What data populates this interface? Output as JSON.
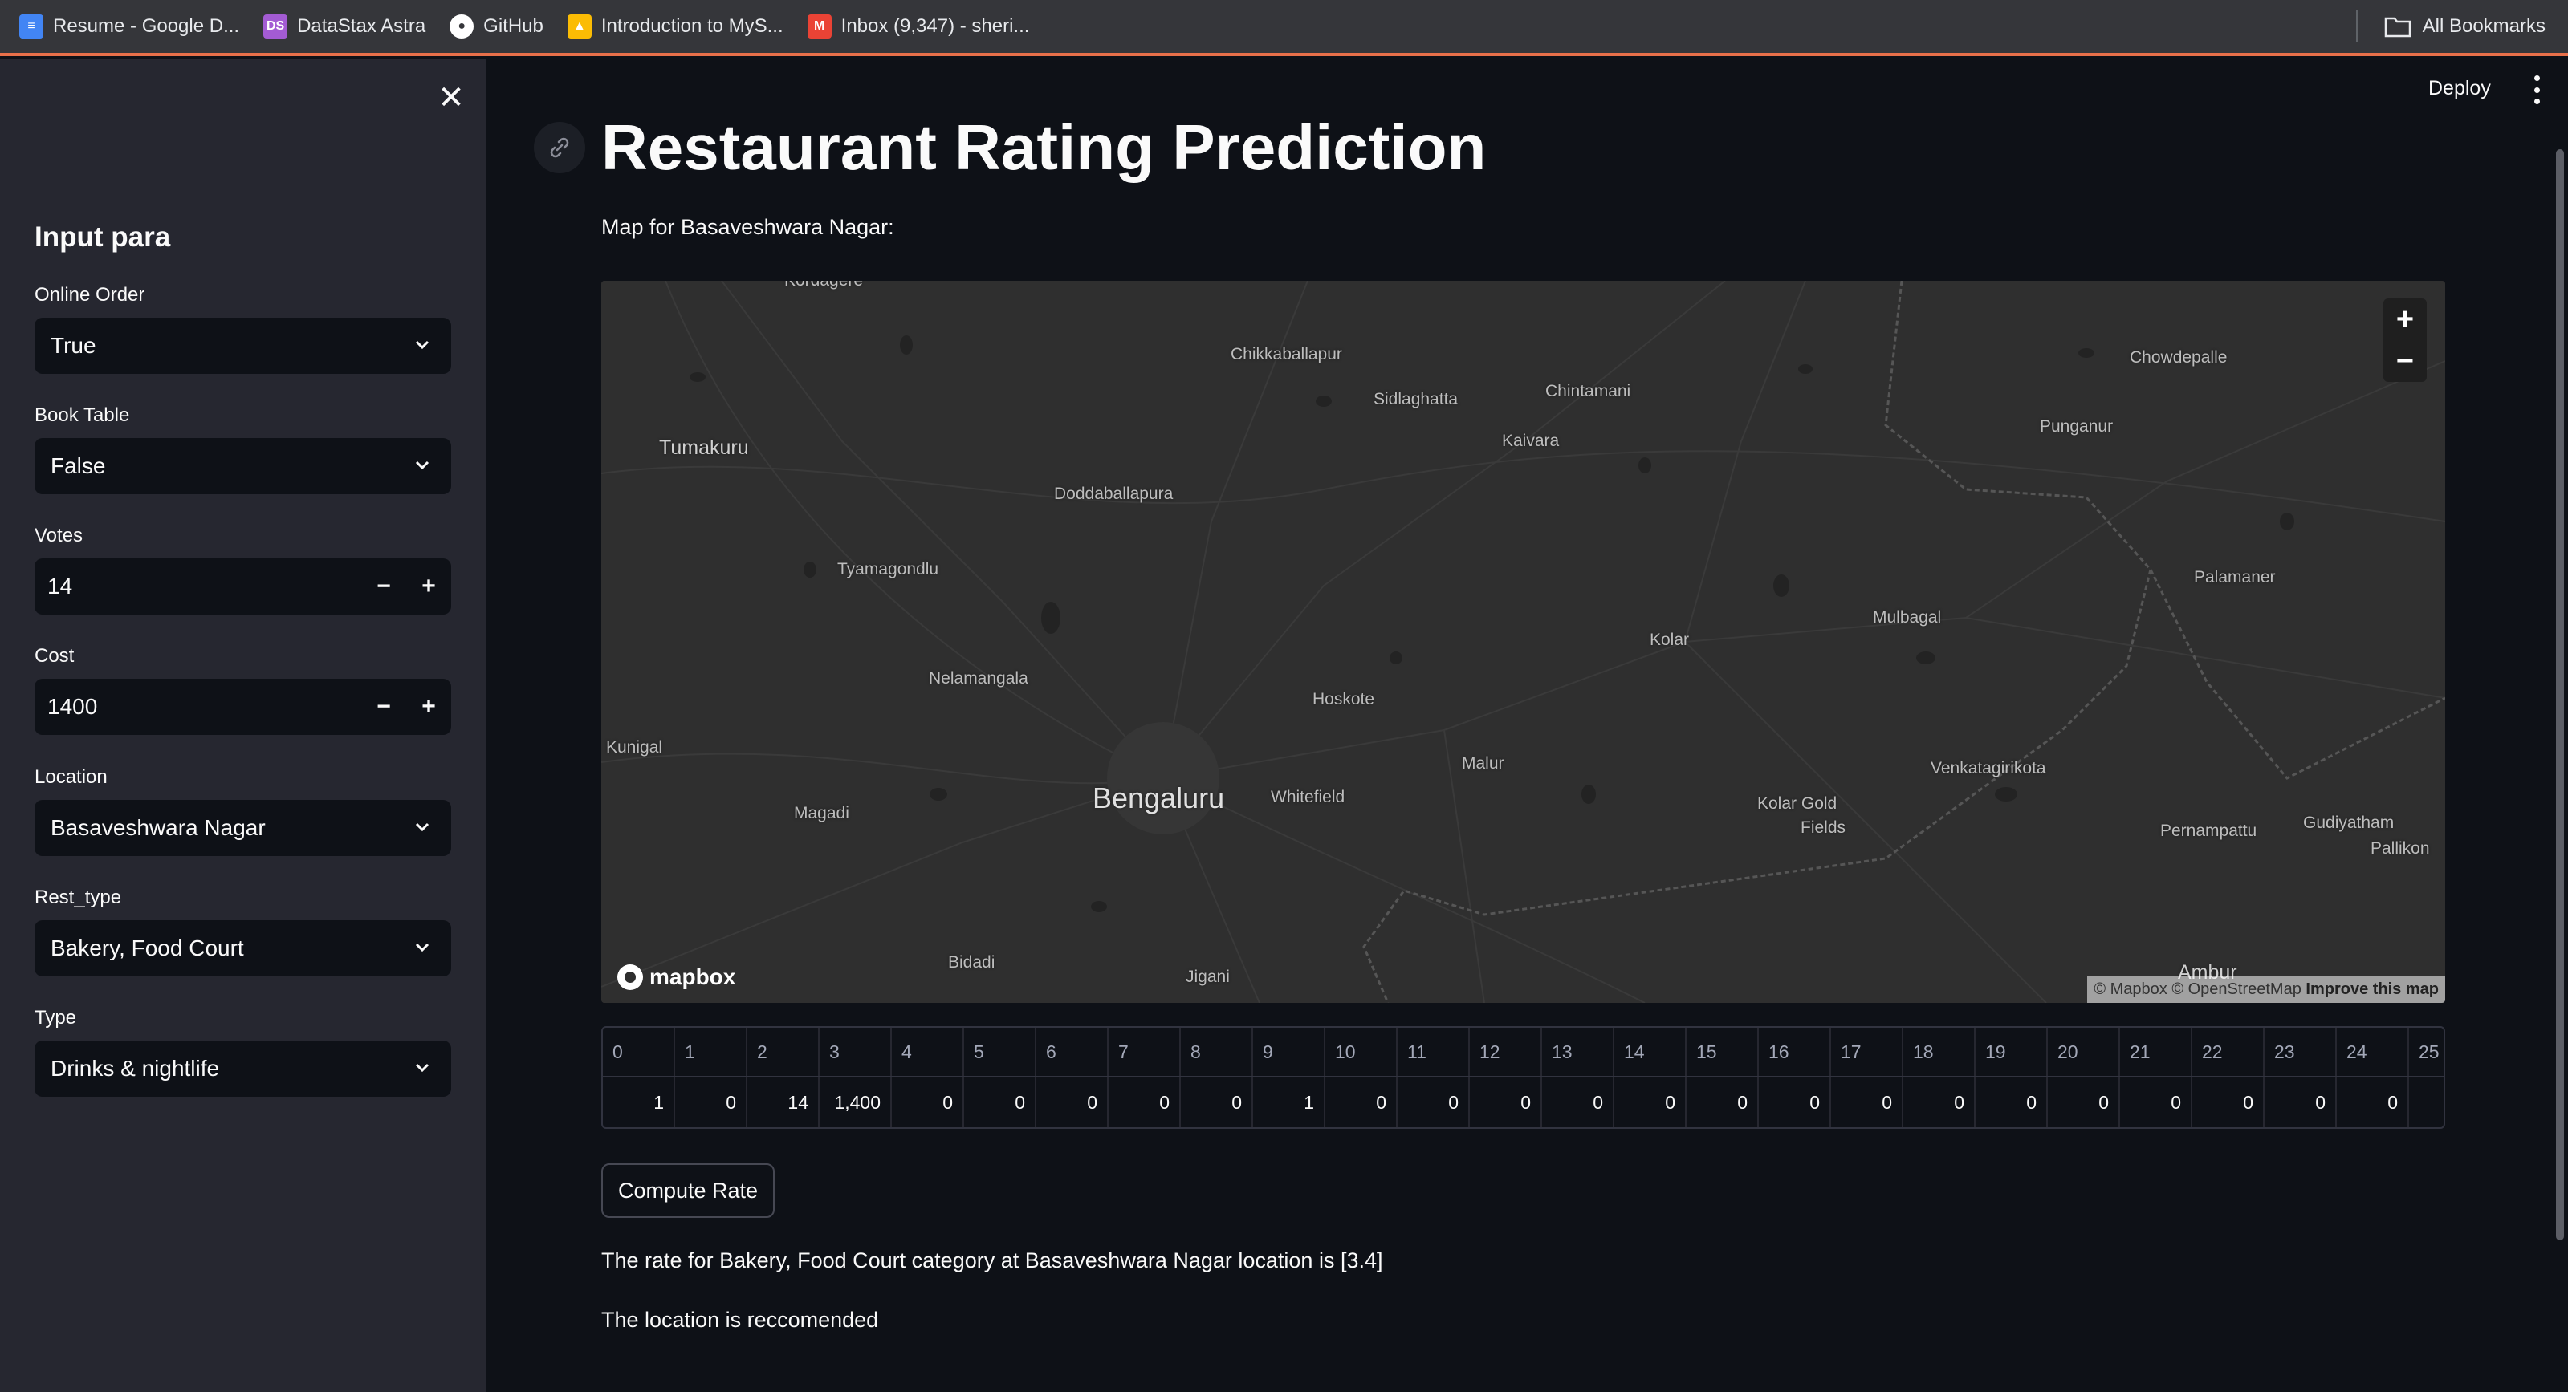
{
  "bookmarks": [
    {
      "label": "Resume - Google D...",
      "icon": "google-docs-icon",
      "color": "#4285f4"
    },
    {
      "label": "DataStax Astra",
      "icon": "datastax-icon",
      "color": "#a35bd3"
    },
    {
      "label": "GitHub",
      "icon": "github-icon",
      "color": "#ffffff"
    },
    {
      "label": "Introduction to MyS...",
      "icon": "google-drive-icon",
      "color": "#fbbc04"
    },
    {
      "label": "Inbox (9,347) - sheri...",
      "icon": "gmail-icon",
      "color": "#ea4335"
    }
  ],
  "all_bookmarks": "All Bookmarks",
  "sidebar": {
    "title": "Input para",
    "online_order": {
      "label": "Online Order",
      "value": "True"
    },
    "book_table": {
      "label": "Book Table",
      "value": "False"
    },
    "votes": {
      "label": "Votes",
      "value": "14",
      "minus": "−",
      "plus": "+"
    },
    "cost": {
      "label": "Cost",
      "value": "1400",
      "minus": "−",
      "plus": "+"
    },
    "location": {
      "label": "Location",
      "value": "Basaveshwara Nagar"
    },
    "rest_type": {
      "label": "Rest_type",
      "value": "Bakery, Food Court"
    },
    "type": {
      "label": "Type",
      "value": "Drinks & nightlife"
    },
    "close_glyph": "✕"
  },
  "header": {
    "deploy": "Deploy"
  },
  "main": {
    "title": "Restaurant Rating Prediction",
    "map_caption": "Map for Basaveshwara Nagar:",
    "compute_button": "Compute Rate",
    "result_rate": "The rate for Bakery, Food Court category at Basaveshwara Nagar location is [3.4]",
    "result_recommend": "The location is reccomended"
  },
  "map": {
    "places": [
      {
        "name": "Kordagere",
        "cls": "place"
      },
      {
        "name": "Chikkaballapur",
        "cls": "place"
      },
      {
        "name": "Sidlaghatta",
        "cls": "place"
      },
      {
        "name": "Chintamani",
        "cls": "place"
      },
      {
        "name": "Chowdepalle",
        "cls": "place"
      },
      {
        "name": "Tumakuru",
        "cls": "town"
      },
      {
        "name": "Kaivara",
        "cls": "place"
      },
      {
        "name": "Punganur",
        "cls": "place"
      },
      {
        "name": "Doddaballapura",
        "cls": "place"
      },
      {
        "name": "Tyamagondlu",
        "cls": "place"
      },
      {
        "name": "Palamaner",
        "cls": "place"
      },
      {
        "name": "Mulbagal",
        "cls": "place"
      },
      {
        "name": "Kolar",
        "cls": "place"
      },
      {
        "name": "Nelamangala",
        "cls": "place"
      },
      {
        "name": "Hoskote",
        "cls": "place"
      },
      {
        "name": "Kunigal",
        "cls": "place"
      },
      {
        "name": "Malur",
        "cls": "place"
      },
      {
        "name": "Venkatagirikota",
        "cls": "place"
      },
      {
        "name": "Bengaluru",
        "cls": "city"
      },
      {
        "name": "Whitefield",
        "cls": "place"
      },
      {
        "name": "Kolar Gold",
        "cls": "place"
      },
      {
        "name": "Fields",
        "cls": "place"
      },
      {
        "name": "Magadi",
        "cls": "place"
      },
      {
        "name": "Pernampattu",
        "cls": "place"
      },
      {
        "name": "Gudiyatham",
        "cls": "place"
      },
      {
        "name": "Pallikon",
        "cls": "place"
      },
      {
        "name": "Bidadi",
        "cls": "place"
      },
      {
        "name": "Jigani",
        "cls": "place"
      },
      {
        "name": "Ambur",
        "cls": "town"
      }
    ],
    "zoom_in": "+",
    "zoom_out": "−",
    "logo": "mapbox",
    "attribution": "© Mapbox © OpenStreetMap",
    "improve": "Improve this map"
  },
  "dataframe": {
    "columns": [
      "0",
      "1",
      "2",
      "3",
      "4",
      "5",
      "6",
      "7",
      "8",
      "9",
      "10",
      "11",
      "12",
      "13",
      "14",
      "15",
      "16",
      "17",
      "18",
      "19",
      "20",
      "21",
      "22",
      "23",
      "24",
      "25"
    ],
    "row": [
      "1",
      "0",
      "14",
      "1,400",
      "0",
      "0",
      "0",
      "0",
      "0",
      "1",
      "0",
      "0",
      "0",
      "0",
      "0",
      "0",
      "0",
      "0",
      "0",
      "0",
      "0",
      "0",
      "0",
      "0",
      "0",
      ""
    ]
  }
}
